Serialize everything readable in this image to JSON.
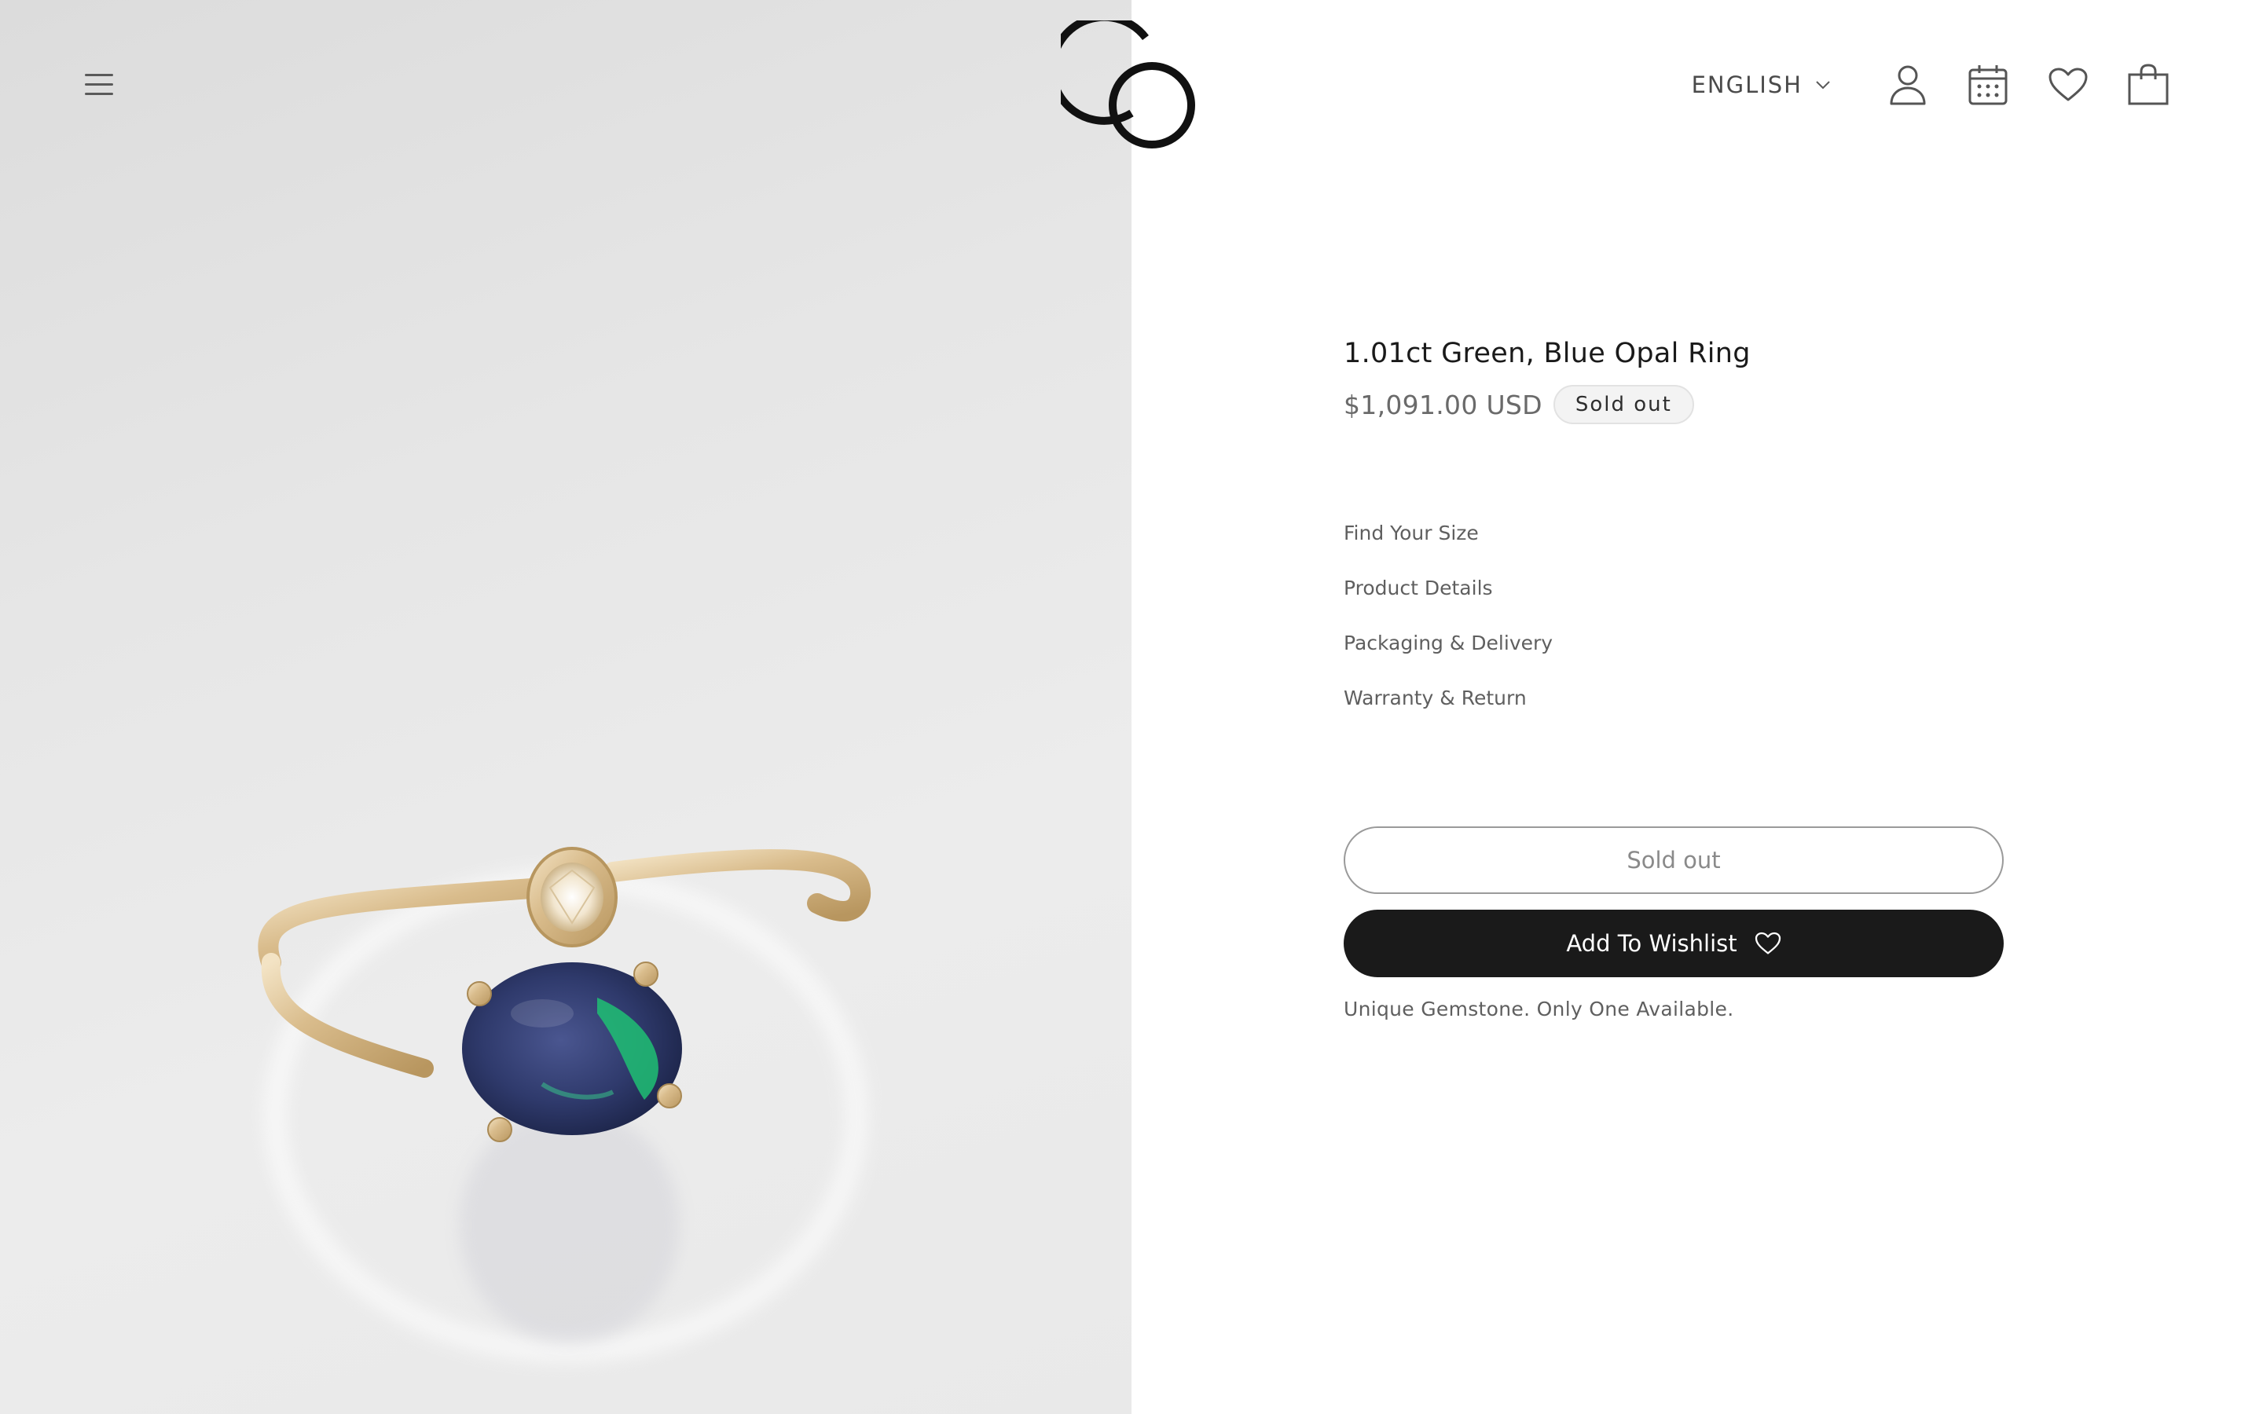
{
  "header": {
    "language_label": "ENGLISH"
  },
  "product": {
    "title": "1.01ct Green, Blue Opal Ring",
    "price": "$1,091.00 USD",
    "status_badge": "Sold out",
    "links": [
      {
        "label": "Find Your Size"
      },
      {
        "label": "Product Details"
      },
      {
        "label": "Packaging & Delivery"
      },
      {
        "label": "Warranty & Return"
      }
    ],
    "sold_out_button": "Sold out",
    "wishlist_button": "Add To Wishlist",
    "availability_note": "Unique Gemstone. Only One Available."
  },
  "icons": {
    "menu": "hamburger-menu-icon",
    "logo": "co-logo",
    "language_dropdown": "chevron-down-icon",
    "account": "user-icon",
    "appointment": "calendar-icon",
    "wishlist": "heart-icon",
    "cart": "shopping-bag-icon"
  },
  "colors": {
    "media_background": "#e6e6e6",
    "button_dark": "#1a1a1a",
    "text_muted": "#5f5f5f",
    "gold": "#d7b98a",
    "opal_blue": "#3a4f86",
    "opal_green": "#1fbf73"
  }
}
